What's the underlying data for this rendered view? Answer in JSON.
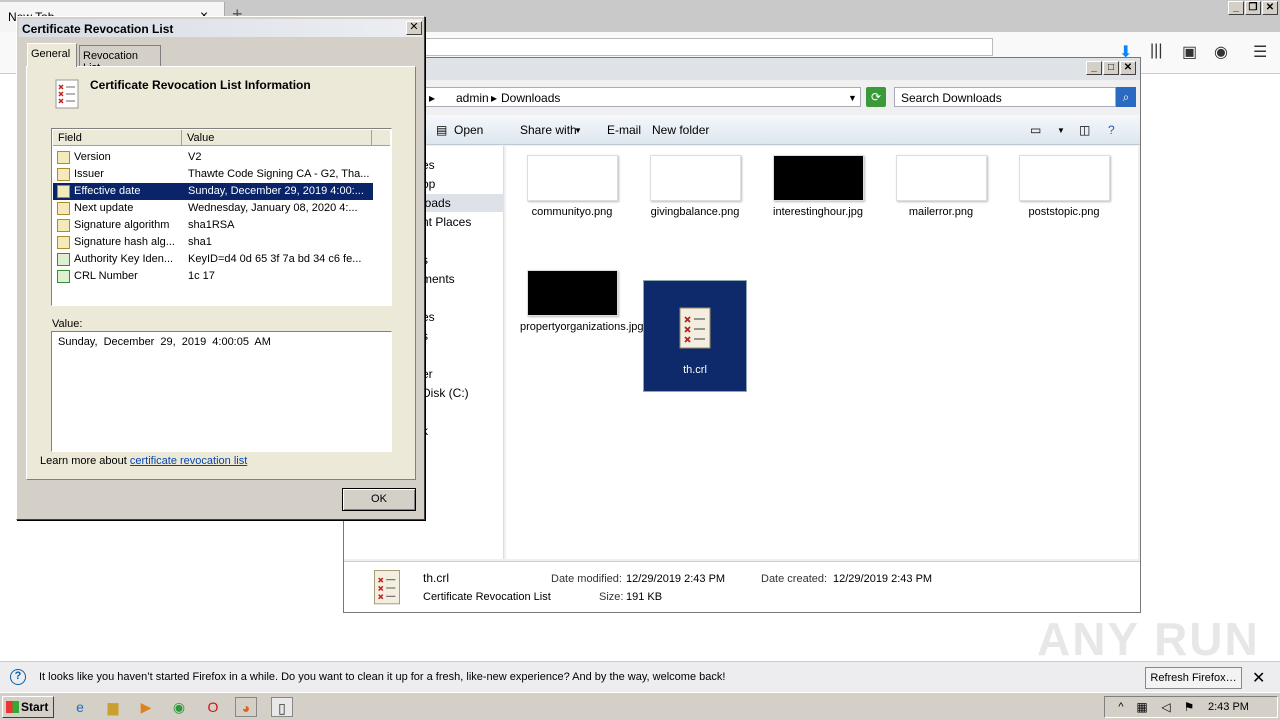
{
  "browser": {
    "tab_title": "New Tab",
    "close_glyph": "×",
    "new_tab_glyph": "+",
    "window_controls": [
      "_",
      "❐",
      "✕"
    ],
    "toolbar_icons": [
      "download-icon",
      "library-icon",
      "sidebar-icon",
      "account-icon",
      "menu-icon"
    ]
  },
  "notification": {
    "text": "It looks like you haven’t started Firefox in a while. Do you want to clean it up for a fresh, like-new experience? And by the way, welcome back!",
    "button": "Refresh Firefox…",
    "close": "✕",
    "icon": "?"
  },
  "explorer": {
    "breadcrumb": [
      "admin",
      "Downloads"
    ],
    "search_placeholder": "Search Downloads",
    "commands": [
      "Open",
      "Share with",
      "E-mail",
      "New folder"
    ],
    "nav_items": [
      "es",
      "op",
      "loads",
      "nt Places",
      "s",
      "ments",
      "es",
      "s",
      "er",
      "Disk (C:)",
      "k"
    ],
    "files": [
      {
        "name": "communityo.png"
      },
      {
        "name": "givingbalance.png"
      },
      {
        "name": "interestinghour.jpg"
      },
      {
        "name": "mailerror.png"
      },
      {
        "name": "poststopic.png"
      },
      {
        "name": "propertyorganizations.jpg"
      },
      {
        "name": "th.crl"
      }
    ],
    "details": {
      "file_name": "th.crl",
      "file_type": "Certificate Revocation List",
      "modified_label": "Date modified:",
      "modified_value": "12/29/2019 2:43 PM",
      "created_label": "Date created:",
      "created_value": "12/29/2019 2:43 PM",
      "size_label": "Size:",
      "size_value": "191 KB"
    }
  },
  "dialog": {
    "title": "Certificate Revocation List",
    "close": "✕",
    "tabs": [
      "General",
      "Revocation List"
    ],
    "info_title": "Certificate Revocation List Information",
    "columns": [
      "Field",
      "Value"
    ],
    "rows": [
      {
        "field": "Version",
        "value": "V2",
        "icon": "cert-field-icon"
      },
      {
        "field": "Issuer",
        "value": "Thawte Code Signing CA - G2, Tha...",
        "icon": "cert-field-icon"
      },
      {
        "field": "Effective date",
        "value": "Sunday, December 29, 2019 4:00:...",
        "icon": "cert-field-icon"
      },
      {
        "field": "Next update",
        "value": "Wednesday, January 08, 2020 4:...",
        "icon": "cert-field-icon"
      },
      {
        "field": "Signature algorithm",
        "value": "sha1RSA",
        "icon": "cert-field-icon"
      },
      {
        "field": "Signature hash alg...",
        "value": "sha1",
        "icon": "cert-field-icon"
      },
      {
        "field": "Authority Key Iden...",
        "value": "KeyID=d4 0d 65 3f 7a bd 34 c6 fe...",
        "icon": "extension-icon"
      },
      {
        "field": "CRL Number",
        "value": "1c 17",
        "icon": "extension-icon"
      }
    ],
    "selected_row": 2,
    "value_label": "Value:",
    "value_text": "Sunday, December 29, 2019 4:00:05 AM",
    "learn_more_prefix": "Learn more about ",
    "learn_more_link": "certificate revocation list",
    "ok": "OK"
  },
  "taskbar": {
    "start": "Start",
    "clock": "2:43 PM"
  },
  "watermark": "ANY RUN"
}
